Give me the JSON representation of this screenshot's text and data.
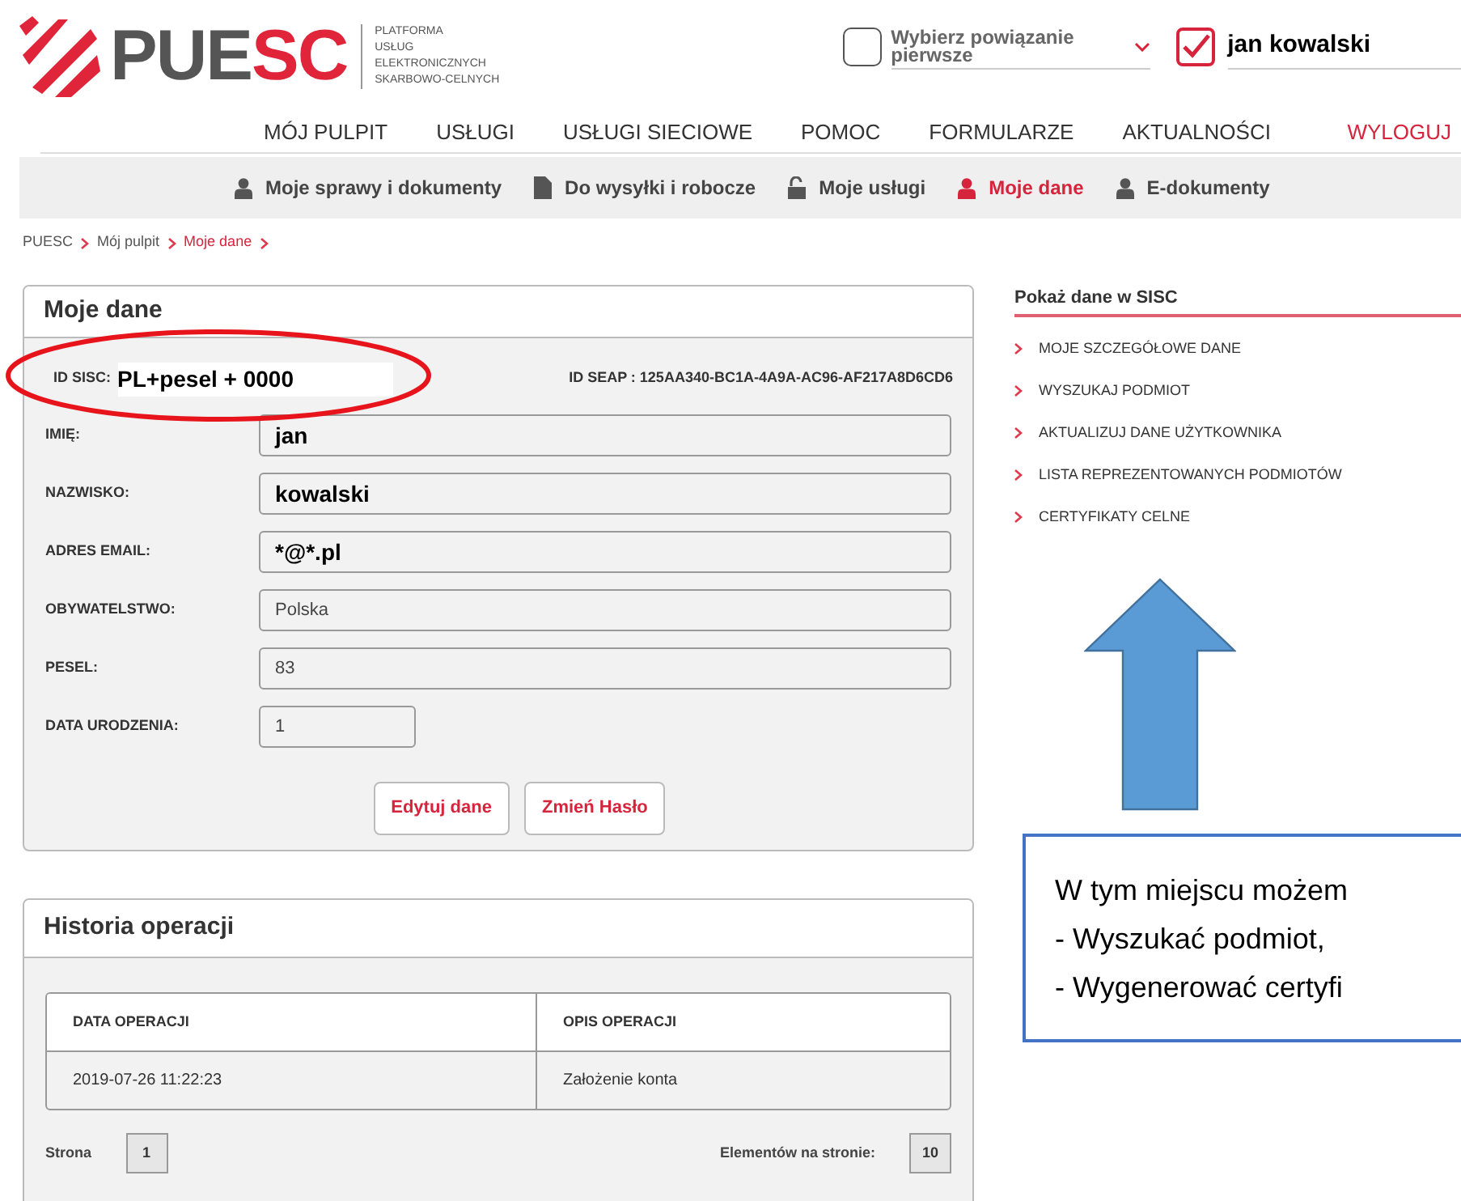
{
  "header": {
    "logo": {
      "part_1": "PUE",
      "part_2": "SC"
    },
    "tagline": [
      "PLATFORMA",
      "USŁUG",
      "ELEKTRONICZNYCH",
      "SKARBOWO-CELNYCH"
    ],
    "relation_select": {
      "checked": false,
      "placeholder": "Wybierz powiązanie pierwsze"
    },
    "user": {
      "checked": true,
      "name": "jan kowalski"
    }
  },
  "main_nav": [
    {
      "label": "MÓJ PULPIT",
      "kind": "link"
    },
    {
      "label": "USŁUGI",
      "kind": "link"
    },
    {
      "label": "USŁUGI SIECIOWE",
      "kind": "link"
    },
    {
      "label": "POMOC",
      "kind": "link"
    },
    {
      "label": "FORMULARZE",
      "kind": "link"
    },
    {
      "label": "AKTUALNOŚCI",
      "kind": "link"
    },
    {
      "label": "WYLOGUJ",
      "kind": "logout"
    }
  ],
  "sub_nav": [
    {
      "label": "Moje sprawy i dokumenty",
      "kind": "user",
      "selected": false
    },
    {
      "label": "Do wysyłki i robocze",
      "kind": "document",
      "selected": false
    },
    {
      "label": "Moje usługi",
      "kind": "lock",
      "selected": false
    },
    {
      "label": "Moje dane",
      "kind": "user",
      "selected": true
    },
    {
      "label": "E-dokumenty",
      "kind": "user",
      "selected": false
    }
  ],
  "breadcrumb": [
    {
      "label": "PUESC",
      "selected": false
    },
    {
      "label": "Mój pulpit",
      "selected": false
    },
    {
      "label": "Moje dane",
      "selected": true
    }
  ],
  "profile": {
    "title": "Moje dane",
    "id_sisc_label": "ID SISC:",
    "id_sisc_value": "PL+pesel + 0000",
    "id_seap": "ID SEAP : 125AA340-BC1A-4A9A-AC96-AF217A8D6CD6",
    "fields": [
      {
        "label": "IMIĘ:",
        "value": "jan",
        "kind": "bold"
      },
      {
        "label": "NAZWISKO:",
        "value": "kowalski",
        "kind": "bold"
      },
      {
        "label": "ADRES EMAIL:",
        "value": "*@*.pl",
        "kind": "bold"
      },
      {
        "label": "OBYWATELSTWO:",
        "value": "Polska",
        "kind": "plain"
      },
      {
        "label": "PESEL:",
        "value": "83",
        "kind": "plain"
      },
      {
        "label": "DATA URODZENIA:",
        "value": "1",
        "kind": "short"
      }
    ],
    "buttons": [
      "Edytuj dane",
      "Zmień Hasło"
    ]
  },
  "history": {
    "title": "Historia operacji",
    "table": {
      "columns": [
        "DATA OPERACJI",
        "OPIS OPERACJI"
      ],
      "rows": [
        [
          "2019-07-26 11:22:23",
          "Założenie konta"
        ]
      ]
    },
    "page_label": "Strona",
    "page": "1",
    "per_page_label": "Elementów na stronie:",
    "per_page": "10"
  },
  "sidebar": {
    "title": "Pokaż dane w SISC",
    "items": [
      "MOJE SZCZEGÓŁOWE DANE",
      "WYSZUKAJ PODMIOT",
      "AKTUALIZUJ DANE UŻYTKOWNIKA",
      "LISTA REPREZENTOWANYCH PODMIOTÓW",
      "CERTYFIKATY CELNE"
    ]
  },
  "annotation": {
    "callout_lines": [
      "W tym miejscu możem",
      "- Wyszukać podmiot,",
      "- Wygenerować certyfi"
    ]
  }
}
